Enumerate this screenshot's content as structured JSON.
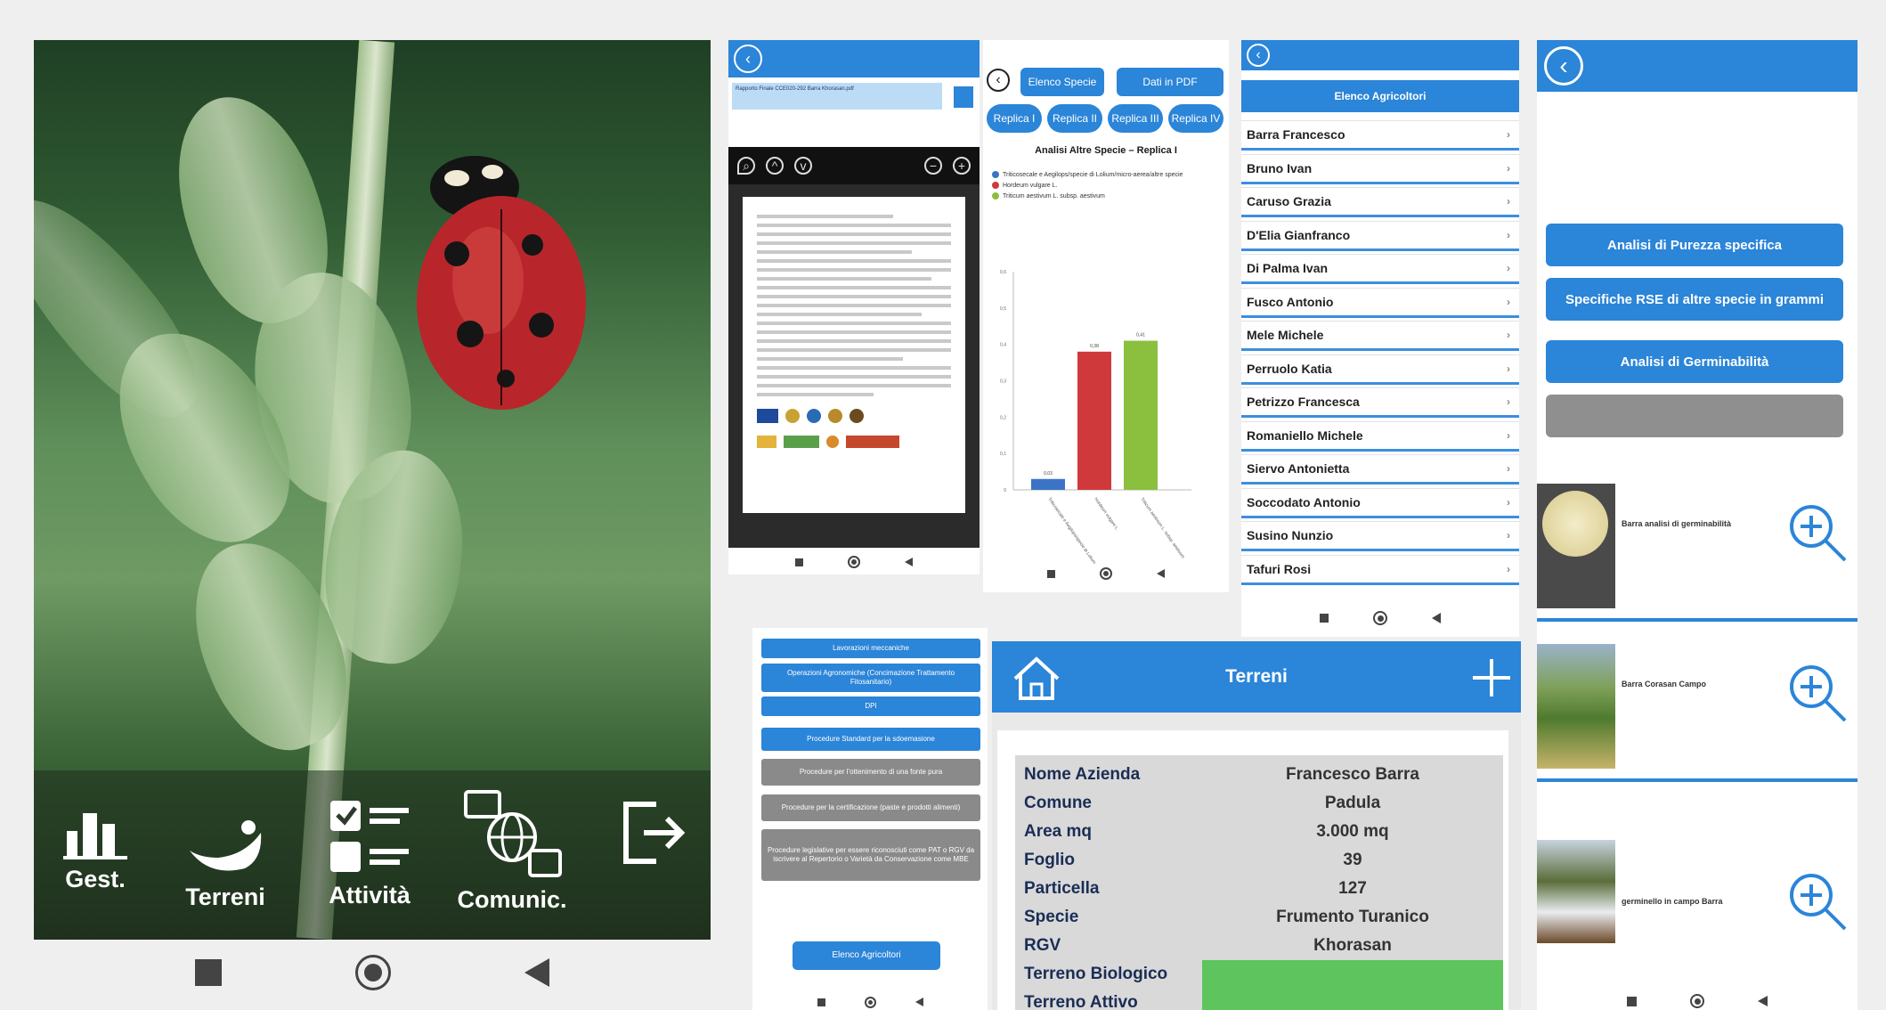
{
  "panel1": {
    "menu": [
      {
        "label": "Gest.",
        "icon": "building-icon"
      },
      {
        "label": "Terreni",
        "icon": "field-icon"
      },
      {
        "label": "Attività",
        "icon": "checklist-icon"
      },
      {
        "label": "Comunic.",
        "icon": "globe-chat-icon"
      },
      {
        "label": "",
        "icon": "logout-icon"
      }
    ]
  },
  "panel2": {
    "filename": "Rapporto Finale CCE020-292 Barra Khorasan.pdf"
  },
  "panel3": {
    "buttons": {
      "elenco_specie": "Elenco Specie",
      "dati_pdf": "Dati in PDF"
    },
    "replicas": [
      "Replica I",
      "Replica II",
      "Replica III",
      "Replica IV"
    ],
    "title": "Analisi Altre Specie – Replica I",
    "legend": [
      {
        "text": "Triticosecale e Aegilops/specie di Lolium/micro-aerea/altre specie",
        "color": "#3b74c6"
      },
      {
        "text": "Hordeum vulgare L.",
        "color": "#d0393b"
      },
      {
        "text": "Triticum aestivum L. subsp. aestivum",
        "color": "#8bbf3e"
      }
    ]
  },
  "chart_data": {
    "type": "bar",
    "title": "Analisi Altre Specie – Replica I",
    "categories": [
      "Triticosecale e Aegilops/specie di Lolium",
      "Hordeum vulgare L.",
      "Triticum aestivum L. subsp. aestivum"
    ],
    "values": [
      0.03,
      0.38,
      0.41
    ],
    "data_labels": [
      "0,03",
      "0,38",
      "0,41"
    ],
    "colors": [
      "#3b74c6",
      "#d0393b",
      "#8bbf3e"
    ],
    "ylim": [
      0,
      0.6
    ],
    "yticks": [
      "0",
      "0,1",
      "0,2",
      "0,3",
      "0,4",
      "0,5",
      "0,6"
    ],
    "grid": false
  },
  "panel4": {
    "header": "Elenco Agricoltori",
    "farmers": [
      "Barra Francesco",
      "Bruno Ivan",
      "Caruso Grazia",
      "D'Elia Gianfranco",
      "Di Palma Ivan",
      "Fusco Antonio",
      "Mele Michele",
      "Perruolo Katia",
      "Petrizzo Francesca",
      "Romaniello Michele",
      "Siervo Antonietta",
      "Soccodato Antonio",
      "Susino Nunzio",
      "Tafuri Rosi"
    ]
  },
  "panel5": {
    "buttons": [
      "Analisi di Purezza specifica",
      "Specifiche RSE di altre specie in grammi",
      "Analisi di Germinabilità",
      ""
    ],
    "items": [
      {
        "label": "Barra analisi di germinabilità"
      },
      {
        "label": "Barra Corasan Campo"
      },
      {
        "label": "germinello in campo Barra"
      }
    ]
  },
  "panel6": {
    "buttons": [
      {
        "label": "Lavorazioni meccaniche",
        "color": "#2b85d8"
      },
      {
        "label": "Operazioni Agronomiche (Concimazione Trattamento Fitosanitario)",
        "color": "#2b85d8"
      },
      {
        "label": "DPI",
        "color": "#2b85d8"
      },
      {
        "label": "Procedure Standard per la sdoemasione",
        "color": "#2b85d8"
      },
      {
        "label": "Procedure per l'ottenimento di una fonte pura",
        "color": "#8a8a8a"
      },
      {
        "label": "Procedure per la certificazione (paste e prodotti alimenti)",
        "color": "#8a8a8a"
      },
      {
        "label": "Procedure legislative per essere riconosciuti come PAT o RGV da iscrivere al Repertorio o Varietà da Conservazione come MBE",
        "color": "#8a8a8a"
      }
    ],
    "footer_button": "Elenco Agricoltori"
  },
  "panel7": {
    "title": "Terreni",
    "rows": [
      {
        "key": "Nome Azienda",
        "value": "Francesco Barra"
      },
      {
        "key": "Comune",
        "value": "Padula"
      },
      {
        "key": "Area mq",
        "value": "3.000 mq"
      },
      {
        "key": "Foglio",
        "value": "39"
      },
      {
        "key": "Particella",
        "value": "127"
      },
      {
        "key": "Specie",
        "value": "Frumento Turanico"
      },
      {
        "key": "RGV",
        "value": "Khorasan"
      },
      {
        "key": "Terreno Biologico",
        "value": ""
      },
      {
        "key": "Terreno Attivo",
        "value": ""
      }
    ],
    "highlight_color": "#5ec45e"
  }
}
